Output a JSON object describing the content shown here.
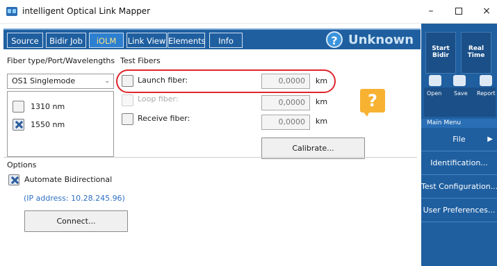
{
  "window": {
    "title": "intelligent Optical Link Mapper",
    "min": "–",
    "close": "×"
  },
  "tabs": [
    {
      "label": "Source"
    },
    {
      "label": "Bidir Job"
    },
    {
      "label": "iOLM"
    },
    {
      "label": "Link View"
    },
    {
      "label": "Elements"
    },
    {
      "label": "Info"
    }
  ],
  "status": {
    "icon": "?",
    "text": "Unknown"
  },
  "left": {
    "fiber_label": "Fiber type/Port/Wavelengths",
    "fiber_type": "OS1 Singlemode",
    "wavelengths": [
      {
        "label": "1310 nm",
        "checked": false
      },
      {
        "label": "1550 nm",
        "checked": true
      }
    ]
  },
  "test_fibers": {
    "title": "Test Fibers",
    "launch": {
      "label": "Launch fiber:",
      "value": "0,0000",
      "unit": "km"
    },
    "loop": {
      "label": "Loop fiber:",
      "value": "0,0000",
      "unit": "km"
    },
    "receive": {
      "label": "Receive fiber:",
      "value": "0,0000",
      "unit": "km"
    },
    "calibrate": "Calibrate...",
    "warning": "?"
  },
  "options": {
    "title": "Options",
    "auto_bidir": "Automate Bidirectional",
    "ip": "(IP address: 10.28.245.96)",
    "connect": "Connect..."
  },
  "sidebar": {
    "start_bidir": "Start Bidir",
    "real_time": "Real Time",
    "open": "Open",
    "save": "Save",
    "report": "Report",
    "main_menu": "Main Menu",
    "menu": [
      {
        "label": "File"
      },
      {
        "label": "Identification..."
      },
      {
        "label": "Test Configuration..."
      },
      {
        "label": "User Preferences..."
      }
    ]
  },
  "colors": {
    "accent": "#1f5fa0",
    "highlight": "#e0252b",
    "warning": "#f7b232",
    "link": "#2d6fc3"
  },
  "icons": [
    "app-icon",
    "help-icon",
    "warning-icon",
    "open-icon",
    "save-icon",
    "report-icon",
    "chevron-down-icon",
    "arrow-right-icon"
  ]
}
